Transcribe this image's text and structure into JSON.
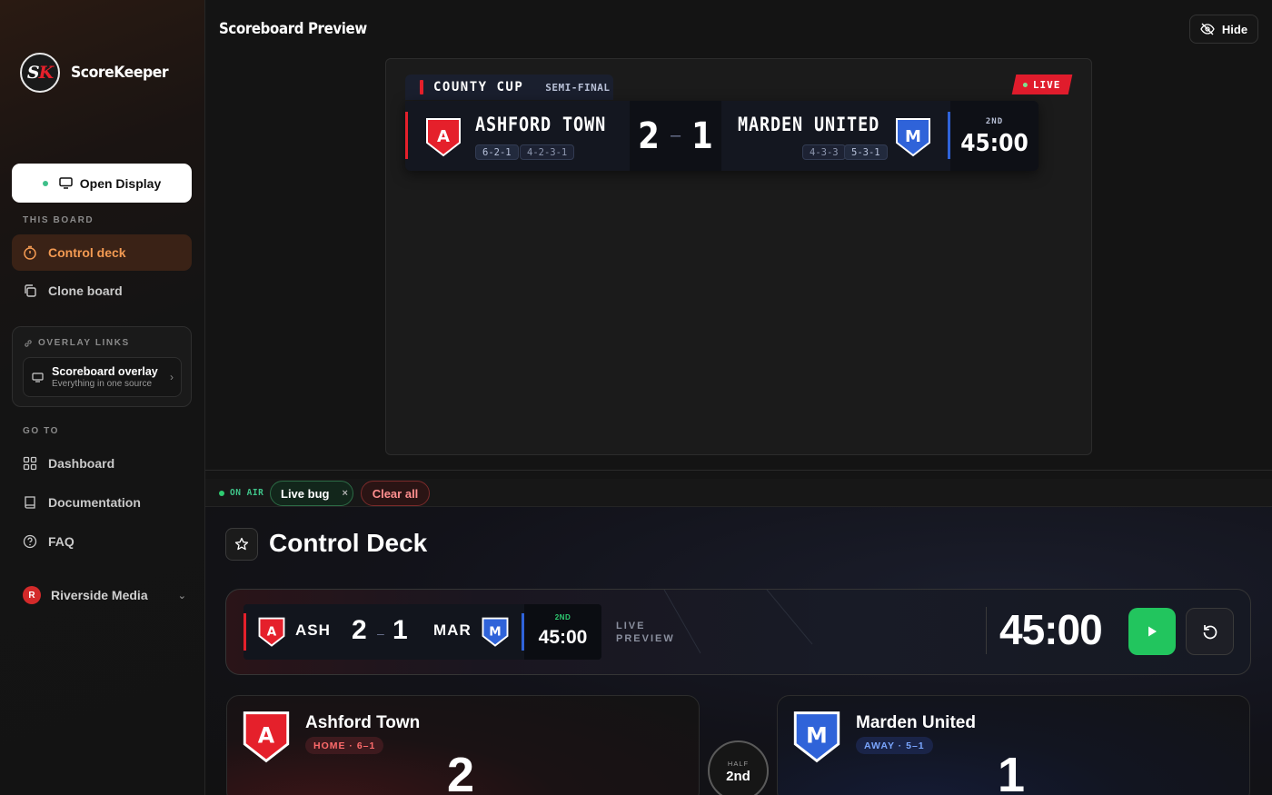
{
  "brand": {
    "logo_s": "S",
    "logo_k": "K",
    "name": "ScoreKeeper"
  },
  "sidebar": {
    "open_display": "Open Display",
    "this_board_label": "THIS BOARD",
    "board_items": [
      {
        "label": "Control deck",
        "icon": "timer-icon",
        "active": true
      },
      {
        "label": "Clone board",
        "icon": "copy-icon",
        "active": false
      }
    ],
    "overlay_links": {
      "label": "OVERLAY LINKS",
      "item": {
        "title": "Scoreboard overlay",
        "subtitle": "Everything in one source"
      }
    },
    "goto_label": "GO TO",
    "goto_items": [
      {
        "label": "Dashboard",
        "icon": "grid-icon"
      },
      {
        "label": "Documentation",
        "icon": "book-icon"
      },
      {
        "label": "FAQ",
        "icon": "help-circle-icon"
      }
    ],
    "org": {
      "initial": "R",
      "name": "Riverside Media"
    }
  },
  "preview": {
    "title": "Scoreboard Preview",
    "hide_label": "Hide",
    "competition": "COUNTY CUP",
    "round": "SEMI-FINAL",
    "live_label": "LIVE",
    "home": {
      "name": "ASHFORD TOWN",
      "badge": "A",
      "formations": [
        "6-2-1",
        "4-2-3-1"
      ],
      "score": "2",
      "color": "#e5202b"
    },
    "away": {
      "name": "MARDEN UNITED",
      "badge": "M",
      "formations": [
        "4-3-3",
        "5-3-1"
      ],
      "score": "1",
      "color": "#2f63d9"
    },
    "score_sep": "–",
    "half": "2ND",
    "clock": "45:00"
  },
  "onair": {
    "label": "ON AIR",
    "chip": "Live bug",
    "chip_close": "×",
    "clear": "Clear all"
  },
  "deck": {
    "title": "Control Deck",
    "mini": {
      "home_abbr": "ASH",
      "away_abbr": "MAR",
      "home_score": "2",
      "away_score": "1",
      "sep": "–",
      "half": "2ND",
      "clock": "45:00"
    },
    "live_preview_1": "LIVE",
    "live_preview_2": "PREVIEW",
    "big_clock": "45:00",
    "home_card": {
      "name": "Ashford Town",
      "tag": "HOME · 6–1",
      "score": "2",
      "badge": "A"
    },
    "away_card": {
      "name": "Marden United",
      "tag": "AWAY · 5–1",
      "score": "1",
      "badge": "M"
    },
    "half_label": "HALF",
    "half_value": "2nd"
  }
}
